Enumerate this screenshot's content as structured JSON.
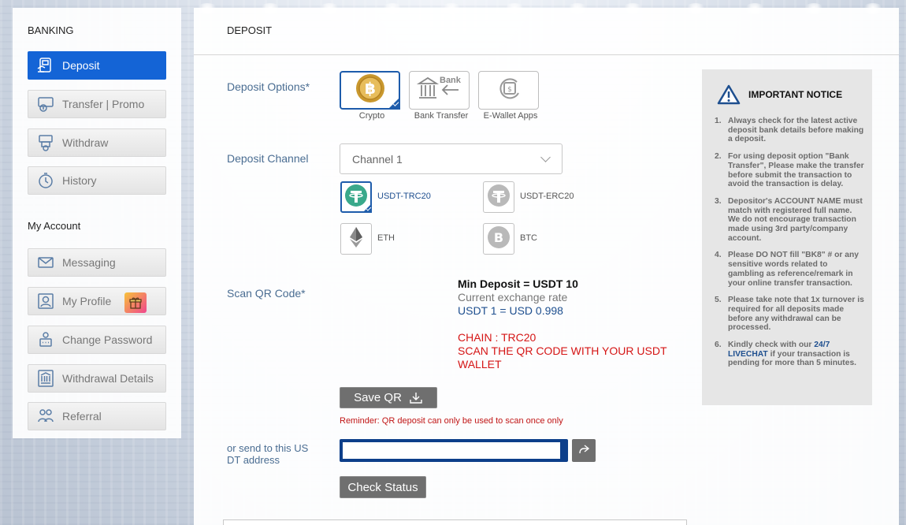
{
  "sidebar": {
    "banking_title": "BANKING",
    "account_title": "My Account",
    "banking_items": [
      {
        "label": "Deposit",
        "icon": "deposit-icon",
        "active": true
      },
      {
        "label": "Transfer | Promo",
        "icon": "transfer-icon"
      },
      {
        "label": "Withdraw",
        "icon": "withdraw-icon"
      },
      {
        "label": "History",
        "icon": "history-icon"
      }
    ],
    "account_items": [
      {
        "label": "Messaging",
        "icon": "envelope-icon"
      },
      {
        "label": "My Profile",
        "icon": "profile-icon",
        "badge_icon": "gift-icon"
      },
      {
        "label": "Change Password",
        "icon": "password-icon"
      },
      {
        "label": "Withdrawal Details",
        "icon": "bank-details-icon"
      },
      {
        "label": "Referral",
        "icon": "referral-icon"
      }
    ]
  },
  "main": {
    "title": "DEPOSIT",
    "deposit_options_label": "Deposit Options*",
    "deposit_options": [
      {
        "label": "Crypto",
        "icon": "bitcoin-icon",
        "selected": true
      },
      {
        "label": "Bank Transfer",
        "icon": "bank-icon",
        "tile_text": "Bank"
      },
      {
        "label": "E-Wallet Apps",
        "icon": "ewallet-icon"
      }
    ],
    "deposit_channel_label": "Deposit Channel",
    "channel_selected": "Channel 1",
    "coins": [
      {
        "label": "USDT-TRC20",
        "icon": "tether-icon",
        "selected": true
      },
      {
        "label": "USDT-ERC20",
        "icon": "tether-icon"
      },
      {
        "label": "ETH",
        "icon": "ethereum-icon"
      },
      {
        "label": "BTC",
        "icon": "bitcoin-icon"
      }
    ],
    "scan_qr_label": "Scan QR Code*",
    "qr_info": {
      "min_deposit": "Min Deposit = USDT 10",
      "rate_label": "Current exchange rate",
      "rate_value": "USDT 1 = USD 0.998",
      "chain": "CHAIN : TRC20",
      "scan_line1": "SCAN THE QR CODE WITH YOUR USDT",
      "scan_line2": "WALLET"
    },
    "save_qr_label": "Save QR",
    "reminder": "Reminder: QR deposit can only be used to scan once only",
    "send_address_label_line1": "or send to this US",
    "send_address_label_line2": "DT address",
    "address_value": "",
    "check_status_label": "Check Status"
  },
  "notice": {
    "title": "IMPORTANT NOTICE",
    "items": [
      {
        "num": "1.",
        "text": "Always check for the latest active deposit bank details before making a deposit."
      },
      {
        "num": "2.",
        "text": "For using deposit option \"Bank Transfer\", Please make the transfer before submit the transaction to avoid the transaction is delay."
      },
      {
        "num": "3.",
        "text": "Depositor's ACCOUNT NAME must match with registered full name. We do not encourage transaction made using 3rd party/company account."
      },
      {
        "num": "4.",
        "text": "Please DO NOT fill \"BK8\" # or any sensitive words related to gambling as reference/remark in your online transfer transaction."
      },
      {
        "num": "5.",
        "text": "Please take note that 1x turnover is required for all deposits made before any withdrawal can be processed."
      },
      {
        "num": "6.",
        "text_before": "Kindly check with our ",
        "highlight": "24/7 LIVECHAT",
        "text_after": " if your transaction is pending for more than 5 minutes."
      }
    ]
  },
  "colors": {
    "accent": "#1464d6",
    "label_blue": "#4a6d92",
    "warning_red": "#d51515",
    "selected_border": "#1e5cab"
  }
}
